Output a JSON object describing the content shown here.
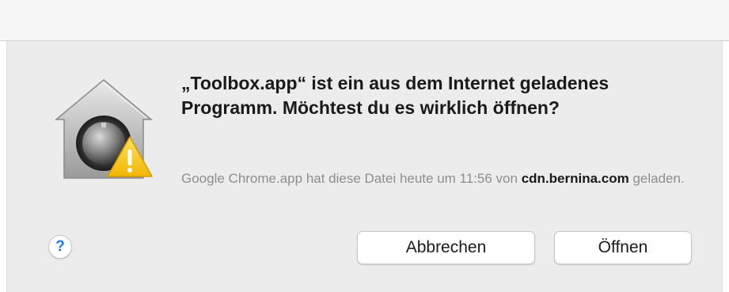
{
  "dialog": {
    "headline": "„Toolbox.app“ ist ein aus dem Internet geladenes Programm. Möchtest du es wirklich öffnen?",
    "info_prefix": "Google Chrome.app hat diese Datei heute um 11:56 von ",
    "info_source": "cdn.bernina.com",
    "info_suffix": " geladen.",
    "help_label": "?",
    "cancel_label": "Abbrechen",
    "open_label": "Öffnen"
  },
  "icons": {
    "app_icon": "gatekeeper-security-icon",
    "help_icon": "question-mark-icon"
  },
  "colors": {
    "sheet_background": "#ececec",
    "help_accent": "#1c7ae8",
    "warning_yellow": "#f5c60a"
  }
}
